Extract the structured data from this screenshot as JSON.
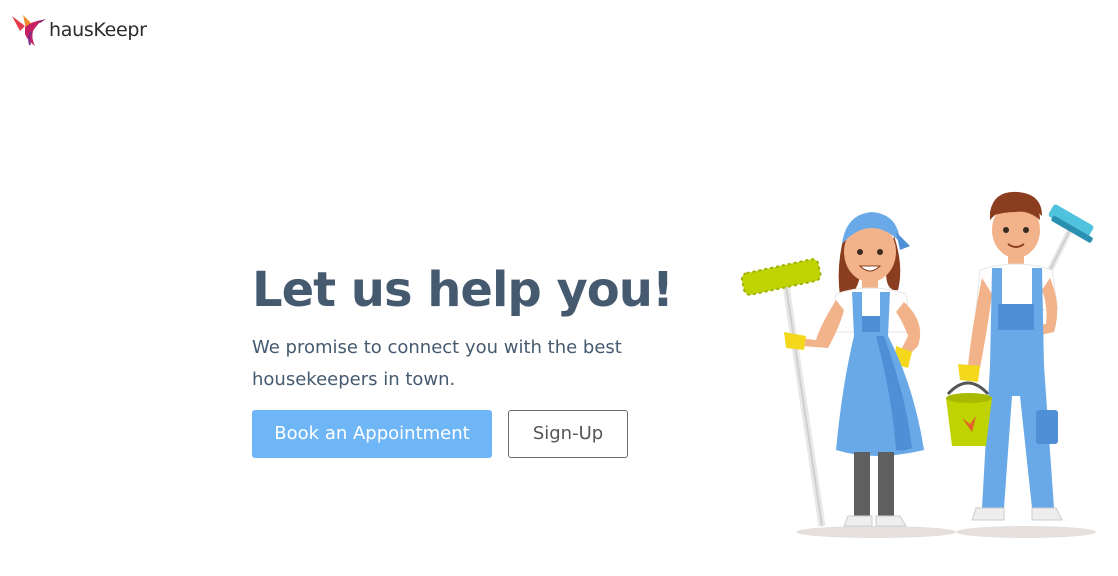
{
  "brand": {
    "name": "hausKeepr",
    "logo_icon": "hummingbird-logo-icon"
  },
  "hero": {
    "title": "Let us help you!",
    "subtitle": "We promise to connect you with the best housekeepers in town."
  },
  "actions": {
    "primary_label": "Book an Appointment",
    "secondary_label": "Sign-Up"
  },
  "illustration": {
    "icon": "housekeepers-illustration"
  },
  "colors": {
    "heading": "#45596f",
    "primary_button": "#6fb6f6",
    "uniform_blue": "#6aa9e8",
    "accent_yellow_green": "#bfd300"
  }
}
